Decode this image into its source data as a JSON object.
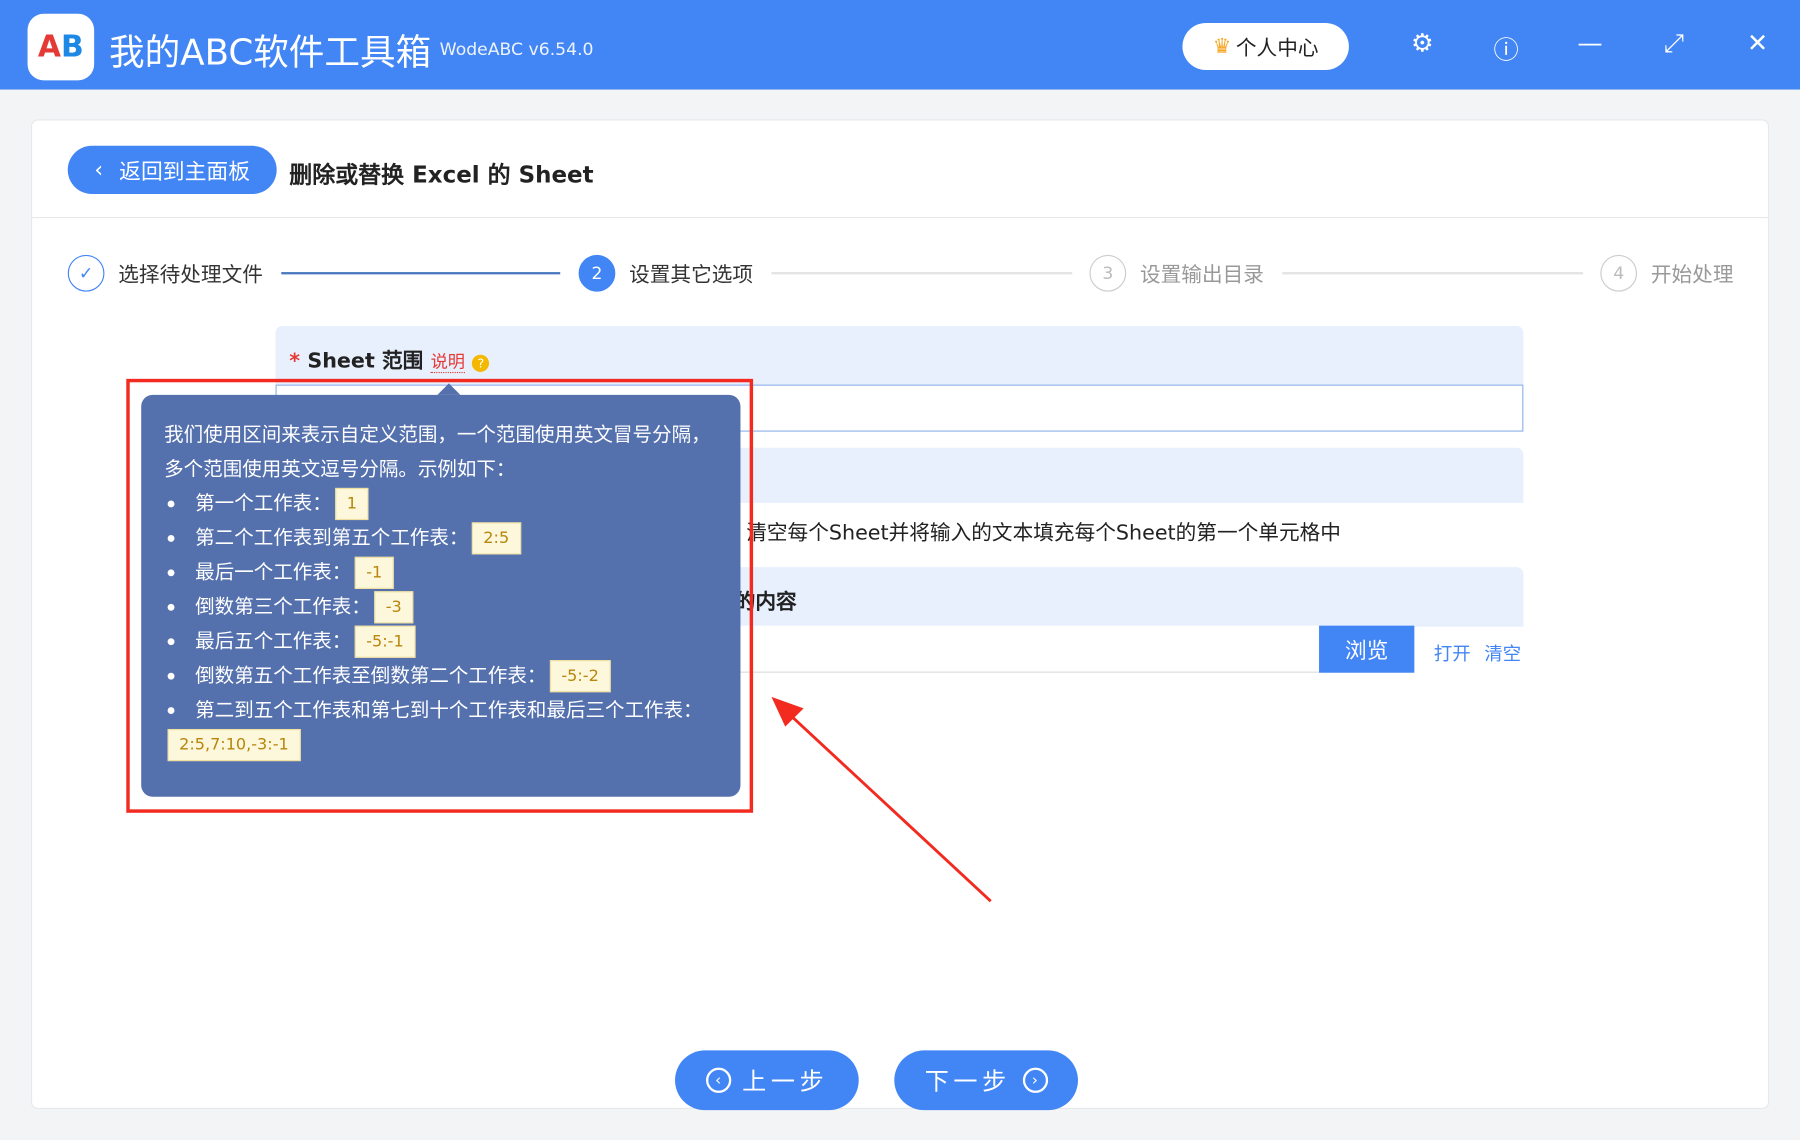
{
  "app": {
    "title": "我的ABC软件工具箱",
    "version": "WodeABC v6.54.0",
    "logo_text": "AB",
    "user_center": "个人中心"
  },
  "header": {
    "back_label": "返回到主面板",
    "page_title": "删除或替换 Excel 的 Sheet"
  },
  "steps": [
    {
      "num": "✓",
      "label": "选择待处理文件"
    },
    {
      "num": "2",
      "label": "设置其它选项"
    },
    {
      "num": "3",
      "label": "设置输出目录"
    },
    {
      "num": "4",
      "label": "开始处理"
    }
  ],
  "form": {
    "sheet_range_label": "Sheet 范围",
    "required_mark": "*",
    "help_link": "说明",
    "help_icon": "?",
    "option_desc": "清空每个Sheet并将输入的文本填充每个Sheet的第一个单元格中",
    "content_label": "的内容",
    "browse": "浏览",
    "open": "打开",
    "clear": "清空"
  },
  "tooltip": {
    "intro": "我们使用区间来表示自定义范围，一个范围使用英文冒号分隔，多个范围使用英文逗号分隔。示例如下：",
    "items": [
      {
        "text": "第一个工作表：",
        "code": "1"
      },
      {
        "text": "第二个工作表到第五个工作表：",
        "code": "2:5"
      },
      {
        "text": "最后一个工作表：",
        "code": "-1"
      },
      {
        "text": "倒数第三个工作表：",
        "code": "-3"
      },
      {
        "text": "最后五个工作表：",
        "code": "-5:-1"
      },
      {
        "text": "倒数第五个工作表至倒数第二个工作表：",
        "code": "-5:-2"
      },
      {
        "text": "第二到五个工作表和第七到十个工作表和最后三个工作表：",
        "code": "2:5,7:10,-3:-1"
      }
    ]
  },
  "footer": {
    "prev": "上一步",
    "next": "下一步"
  },
  "colors": {
    "primary": "#4285f4",
    "tooltip": "#5470ad",
    "highlight": "#f22a1f"
  }
}
